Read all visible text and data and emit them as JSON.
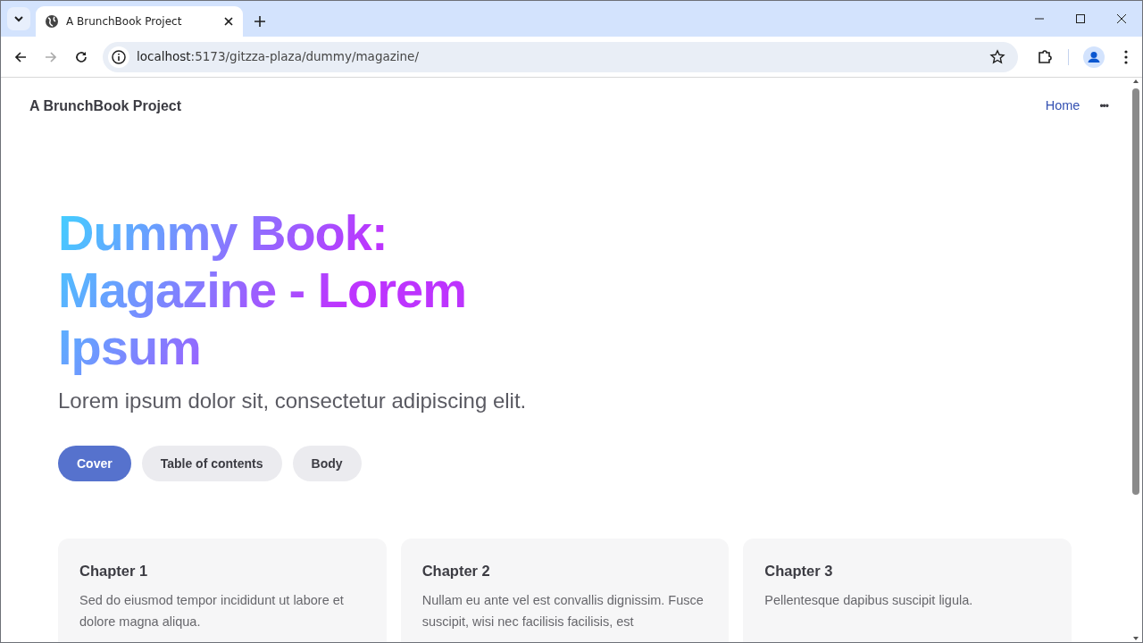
{
  "browser": {
    "tab_title": "A BrunchBook Project",
    "url_host": "localhost",
    "url_path": ":5173/gitzza-plaza/dummy/magazine/"
  },
  "site": {
    "title": "A BrunchBook Project",
    "nav": [
      {
        "label": "Home",
        "kind": "link"
      },
      {
        "label": "•••",
        "kind": "more"
      }
    ]
  },
  "hero": {
    "title": "Dummy Book: Magazine - Lorem Ipsum",
    "tagline": "Lorem ipsum dolor sit, consectetur adipiscing elit.",
    "buttons": [
      {
        "label": "Cover",
        "selected": true
      },
      {
        "label": "Table of contents",
        "selected": false
      },
      {
        "label": "Body",
        "selected": false
      }
    ]
  },
  "chapters": [
    {
      "title": "Chapter 1",
      "text": "Sed do eiusmod tempor incididunt ut labore et dolore magna aliqua."
    },
    {
      "title": "Chapter 2",
      "text": "Nullam eu ante vel est convallis dignissim. Fusce suscipit, wisi nec facilisis facilisis, est"
    },
    {
      "title": "Chapter 3",
      "text": "Pellentesque dapibus suscipit ligula."
    }
  ]
}
